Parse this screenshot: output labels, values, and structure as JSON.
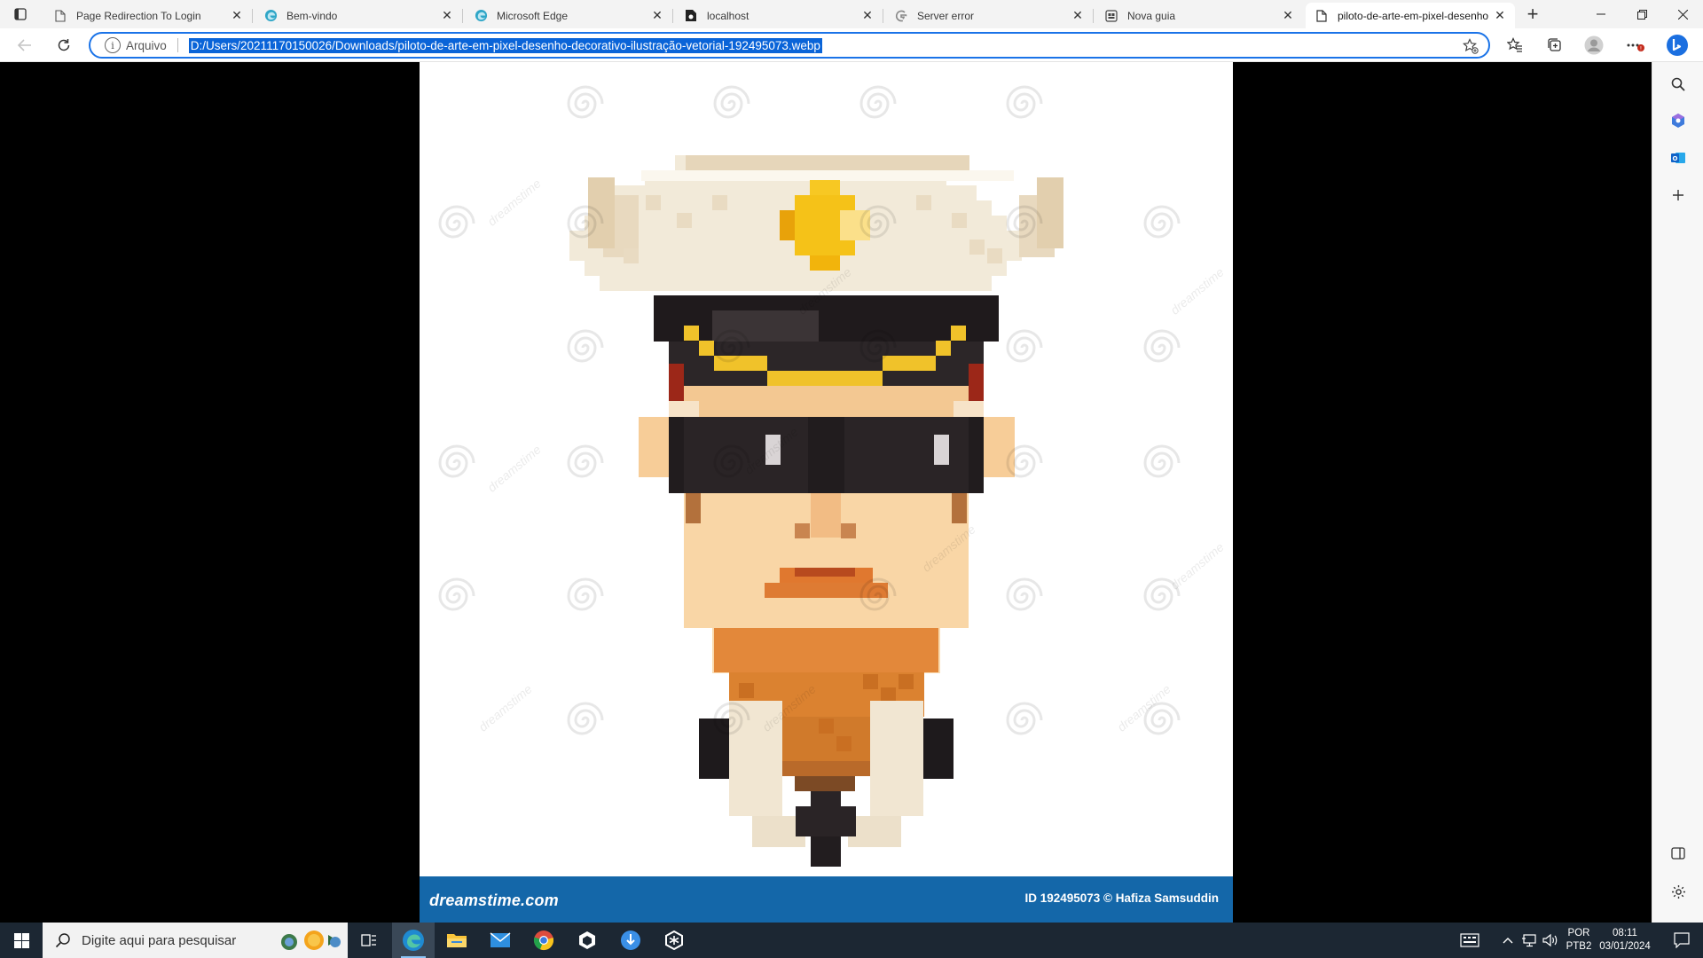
{
  "browser": {
    "tabs": [
      {
        "title": "Page Redirection To Login",
        "favicon": "page-icon",
        "active": false
      },
      {
        "title": "Bem-vindo",
        "favicon": "edge-icon",
        "active": false
      },
      {
        "title": "Microsoft Edge",
        "favicon": "edge-icon",
        "active": false
      },
      {
        "title": "localhost",
        "favicon": "document-icon",
        "active": false
      },
      {
        "title": "Server error",
        "favicon": "google-icon",
        "active": false
      },
      {
        "title": "Nova guia",
        "favicon": "newtab-icon",
        "active": false
      },
      {
        "title": "piloto-de-arte-em-pixel-desenho",
        "favicon": "page-icon",
        "active": true
      }
    ],
    "address": {
      "protocol_label": "Arquivo",
      "url": "D:/Users/20211170150026/Downloads/piloto-de-arte-em-pixel-desenho-decorativo-ilustração-vetorial-192495073.webp"
    },
    "accent_color": "#0a64d8"
  },
  "image": {
    "footer_logo": "dreamstime.com",
    "footer_credit": "ID 192495073 © Hafiza Samsuddin",
    "watermark_text": "dreamstime",
    "footer_color": "#1467a9"
  },
  "taskbar": {
    "search_placeholder": "Digite aqui para pesquisar",
    "language_top": "POR",
    "language_bottom": "PTB2",
    "time": "08:11",
    "date": "03/01/2024"
  }
}
